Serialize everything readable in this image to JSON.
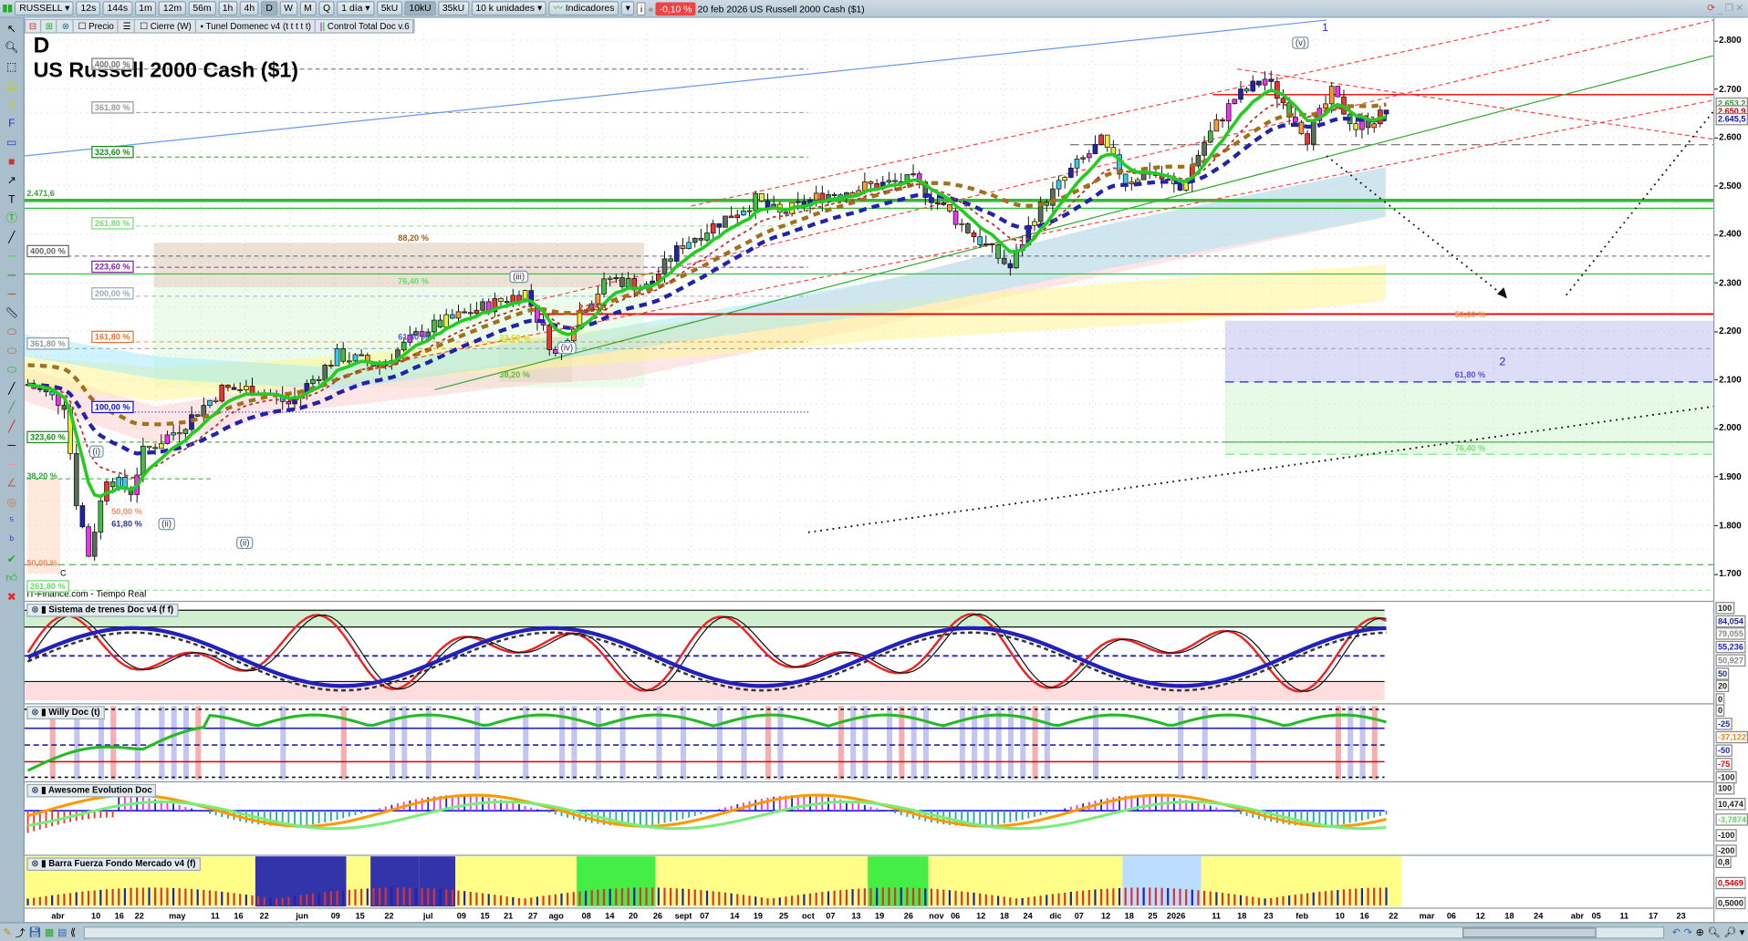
{
  "toolbar": {
    "symbol": "RUSSELL",
    "timeframes": [
      "12s",
      "144s",
      "1m",
      "12m",
      "56m",
      "1h",
      "4h",
      "D",
      "W",
      "M",
      "Q"
    ],
    "active_timeframe": "D",
    "period": "1 día",
    "volumes": [
      "5kU",
      "10kU",
      "35kU"
    ],
    "active_volume": "10kU",
    "units": "10 k unidades",
    "indicators": "Indicadores",
    "change": "-0,10 %",
    "date": "20 feb 2026",
    "instrument": "US Russell 2000 Cash ($1)"
  },
  "legend": {
    "items": [
      "Precio",
      "Cierre (W)",
      "Tunel Domenec v4 (t t t t t)",
      "Control Total Doc v.6"
    ]
  },
  "chart": {
    "period_letter": "D",
    "title": "US Russell 2000 Cash ($1)",
    "source": "IT-Finance.com - Tiempo Real",
    "level_label": "2.471,6",
    "price_marker": "2.235,3",
    "wave_c": "C"
  },
  "fib_labels": [
    "400,00 %",
    "361,80 %",
    "323,60 %",
    "261,80 %",
    "400,00 %",
    "223,60 %",
    "200,00 %",
    "161,80 %",
    "361,80 %",
    "100,00 %",
    "323,60 %",
    "38,20 %",
    "50,00 %",
    "61,80 %",
    "50,00 %",
    "261,80 %",
    "88,20 %",
    "76,40 %",
    "61,80 %",
    "23,60 %",
    "38,20 %",
    "50,00 %",
    "61,80 %",
    "76,40 %"
  ],
  "waves": [
    "(i)",
    "(ii)",
    "(ii)",
    "(iii)",
    "(iv)",
    "(v)",
    "1",
    "2"
  ],
  "price_axis": {
    "ticks": [
      "2.800",
      "2.700",
      "2.600",
      "2.500",
      "2.400",
      "2.300",
      "2.200",
      "2.100",
      "2.000",
      "1.900",
      "1.800",
      "1.700"
    ],
    "tags": [
      "2.653,2",
      "2.650,9",
      "2.645,5"
    ],
    "colors": [
      "#2a9a2a",
      "#d00000",
      "#1010b0"
    ]
  },
  "panels": [
    {
      "title": "Sistema de trenes Doc v4 (f f)",
      "axis": [
        "100",
        "84,054",
        "79,055",
        "55,236",
        "50,927",
        "50",
        "20",
        "0"
      ]
    },
    {
      "title": "Willy Doc (t)",
      "axis": [
        "0",
        "-25",
        "-37,122",
        "-50",
        "-75",
        "-100"
      ]
    },
    {
      "title": "Awesome Evolution Doc",
      "axis": [
        "100",
        "10,474",
        "-3,7874",
        "-100",
        "-200"
      ]
    },
    {
      "title": "Barra Fuerza Fondo Mercado v4 (f)",
      "axis": [
        "0,8",
        "0,5469",
        "0,5000"
      ]
    }
  ],
  "date_axis": [
    "abr",
    "10",
    "16",
    "22",
    "may",
    "11",
    "16",
    "22",
    "jun",
    "09",
    "15",
    "22",
    "jul",
    "09",
    "15",
    "21",
    "27",
    "ago",
    "08",
    "14",
    "20",
    "26",
    "sept",
    "07",
    "14",
    "19",
    "25",
    "oct",
    "07",
    "13",
    "19",
    "26",
    "nov",
    "06",
    "12",
    "18",
    "24",
    "dic",
    "07",
    "12",
    "18",
    "25",
    "2026",
    "11",
    "18",
    "23",
    "feb",
    "10",
    "16",
    "22",
    "mar",
    "06",
    "12",
    "18",
    "24",
    "abr",
    "05",
    "11",
    "17",
    "23"
  ],
  "chart_data": {
    "type": "candlestick",
    "price_path": [
      [
        0,
        2090
      ],
      [
        6,
        2050
      ],
      [
        8,
        1850
      ],
      [
        10,
        1740
      ],
      [
        13,
        1900
      ],
      [
        17,
        1870
      ],
      [
        19,
        1950
      ],
      [
        25,
        2000
      ],
      [
        32,
        2080
      ],
      [
        38,
        2080
      ],
      [
        43,
        2050
      ],
      [
        51,
        2150
      ],
      [
        58,
        2130
      ],
      [
        65,
        2200
      ],
      [
        73,
        2240
      ],
      [
        82,
        2280
      ],
      [
        87,
        2150
      ],
      [
        91,
        2240
      ],
      [
        96,
        2310
      ],
      [
        102,
        2290
      ],
      [
        108,
        2380
      ],
      [
        120,
        2470
      ],
      [
        124,
        2440
      ],
      [
        131,
        2480
      ],
      [
        139,
        2500
      ],
      [
        146,
        2510
      ],
      [
        154,
        2420
      ],
      [
        162,
        2330
      ],
      [
        166,
        2440
      ],
      [
        172,
        2530
      ],
      [
        177,
        2590
      ],
      [
        181,
        2510
      ],
      [
        185,
        2530
      ],
      [
        190,
        2490
      ],
      [
        194,
        2590
      ],
      [
        199,
        2680
      ],
      [
        204,
        2720
      ],
      [
        209,
        2640
      ],
      [
        211,
        2600
      ],
      [
        215,
        2690
      ],
      [
        219,
        2620
      ],
      [
        224,
        2650
      ]
    ],
    "ylim": [
      1680,
      2830
    ]
  }
}
